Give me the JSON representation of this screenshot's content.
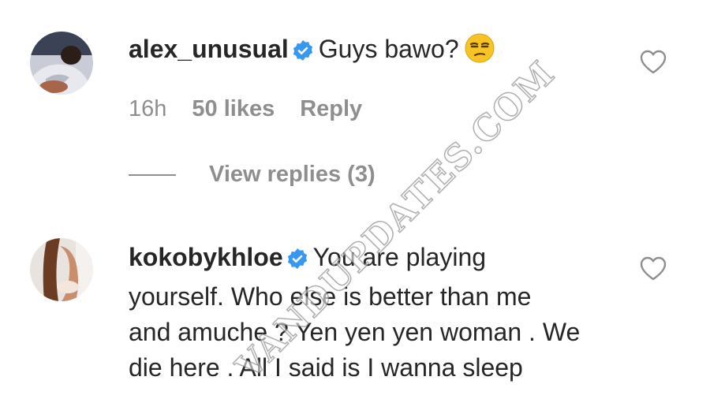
{
  "comments": [
    {
      "username": "alex_unusual",
      "text": "Guys bawo?",
      "time": "16h",
      "likes": "50 likes",
      "reply_label": "Reply",
      "view_replies": "View replies (3)",
      "emoji": "unamused-face-emoji"
    },
    {
      "username": "kokobykhloe",
      "text_lines": [
        "You are playing",
        "yourself. Who else is better than me",
        "and amuche ? Yen yen yen woman . We",
        "die here . All I said is I wanna sleep"
      ]
    }
  ],
  "watermark": "VANDUPDATES.COM",
  "colors": {
    "verified": "#3897f0",
    "secondary_text": "#8e8e8e",
    "primary_text": "#262626"
  }
}
